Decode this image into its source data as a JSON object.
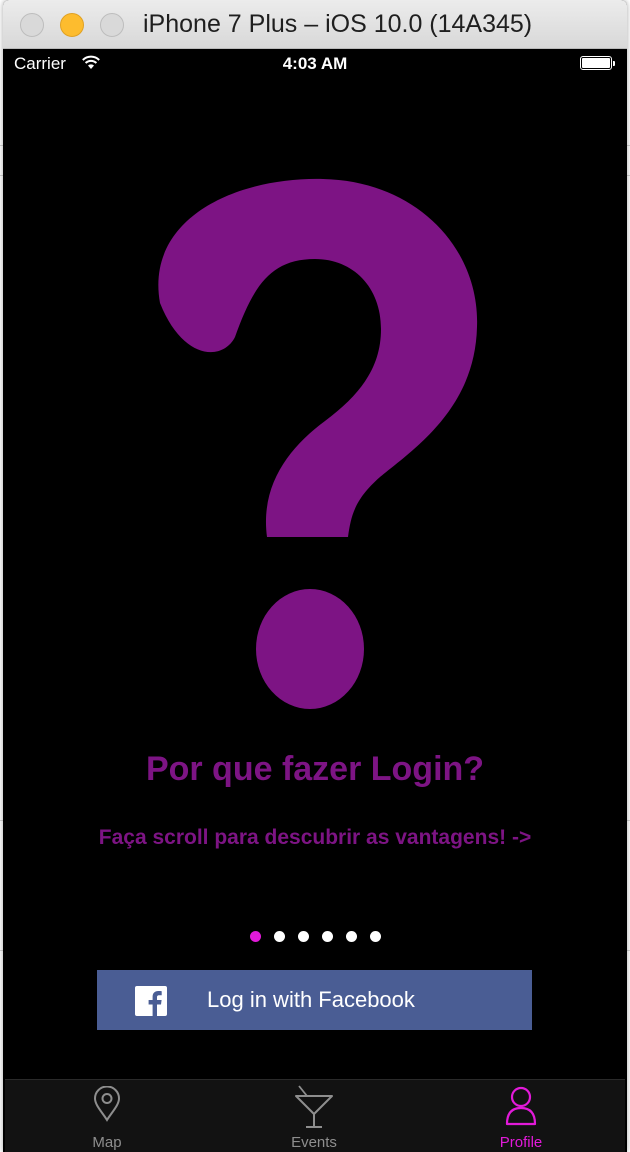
{
  "window": {
    "title": "iPhone 7 Plus – iOS 10.0 (14A345)"
  },
  "status_bar": {
    "carrier": "Carrier",
    "time": "4:03 AM"
  },
  "content": {
    "headline": "Por que fazer Login?",
    "subline": "Faça scroll para descubrir as vantagens! ->"
  },
  "pager": {
    "page_count": 6,
    "current_page": 1
  },
  "login": {
    "facebook_label": "Log in with Facebook"
  },
  "tab_bar": {
    "tabs": [
      {
        "label": "Map",
        "icon": "map-pin-icon",
        "selected": false
      },
      {
        "label": "Events",
        "icon": "cocktail-icon",
        "selected": false
      },
      {
        "label": "Profile",
        "icon": "person-icon",
        "selected": true
      }
    ]
  },
  "colors": {
    "accent": "#e21ad9",
    "question_mark": "#7d1484",
    "facebook_blue": "#4a5d94"
  }
}
